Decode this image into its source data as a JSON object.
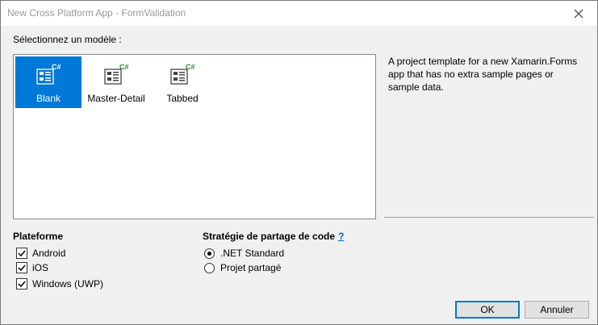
{
  "window": {
    "title": "New Cross Platform App - FormValidation"
  },
  "templates": {
    "section_label": "Sélectionnez un modèle :",
    "items": [
      {
        "label": "Blank",
        "badge": "C#",
        "selected": true
      },
      {
        "label": "Master-Detail",
        "badge": "C#",
        "selected": false
      },
      {
        "label": "Tabbed",
        "badge": "C#",
        "selected": false
      }
    ],
    "description": "A project template for a new Xamarin.Forms app that has no extra sample pages or sample data."
  },
  "platform": {
    "title": "Plateforme",
    "options": [
      {
        "label": "Android",
        "checked": true
      },
      {
        "label": "iOS",
        "checked": true
      },
      {
        "label": "Windows (UWP)",
        "checked": true
      }
    ]
  },
  "sharing": {
    "title": "Stratégie de partage de code",
    "help": "?",
    "options": [
      {
        "label": ".NET Standard",
        "selected": true
      },
      {
        "label": "Projet partagé",
        "selected": false
      }
    ]
  },
  "buttons": {
    "ok": "OK",
    "cancel": "Annuler"
  },
  "colors": {
    "selection": "#0078d7",
    "badge": "#2e8b3a",
    "link": "#0066cc"
  }
}
